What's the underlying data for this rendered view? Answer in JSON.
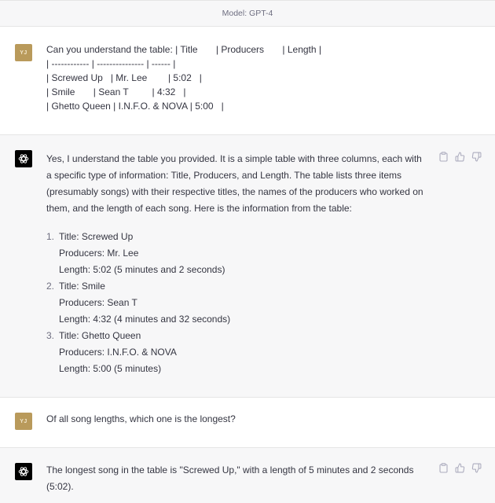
{
  "header": {
    "model_label": "Model: GPT-4"
  },
  "messages": [
    {
      "role": "user",
      "avatar_initials": "YJ",
      "lines": [
        "Can you understand the table: | Title       | Producers       | Length |",
        "| ------------ | --------------- | ------ |",
        "| Screwed Up   | Mr. Lee        | 5:02   |",
        "| Smile       | Sean T         | 4:32   |",
        "| Ghetto Queen | I.N.F.O. & NOVA | 5:00   |"
      ]
    },
    {
      "role": "assistant",
      "intro": "Yes, I understand the table you provided. It is a simple table with three columns, each with a specific type of information: Title, Producers, and Length. The table lists three items (presumably songs) with their respective titles, the names of the producers who worked on them, and the length of each song. Here is the information from the table:",
      "list": [
        {
          "num": "1.",
          "title": "Title: Screwed Up",
          "producers": "Producers: Mr. Lee",
          "length": "Length: 5:02 (5 minutes and 2 seconds)"
        },
        {
          "num": "2.",
          "title": "Title: Smile",
          "producers": "Producers: Sean T",
          "length": "Length: 4:32 (4 minutes and 32 seconds)"
        },
        {
          "num": "3.",
          "title": "Title: Ghetto Queen",
          "producers": "Producers: I.N.F.O. & NOVA",
          "length": "Length: 5:00 (5 minutes)"
        }
      ]
    },
    {
      "role": "user",
      "avatar_initials": "YJ",
      "text": "Of all song lengths, which one is the longest?"
    },
    {
      "role": "assistant",
      "text": "The longest song in the table is \"Screwed Up,\" with a length of 5 minutes and 2 seconds (5:02)."
    }
  ],
  "icons": {
    "copy": "clipboard-icon",
    "like": "thumbs-up-icon",
    "dislike": "thumbs-down-icon"
  },
  "colors": {
    "user_avatar": "#b99a5b",
    "assistant_avatar": "#000000",
    "assistant_bg": "#f7f7f8"
  }
}
